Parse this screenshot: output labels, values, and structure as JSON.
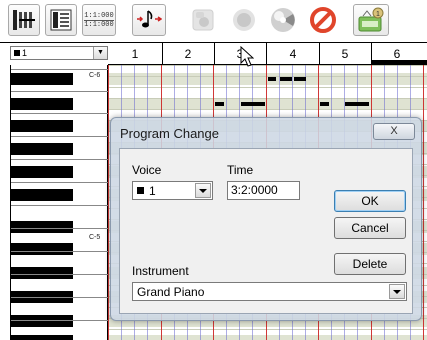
{
  "toolbar": {
    "buttons": [
      {
        "name": "track-view-icon"
      },
      {
        "name": "list-view-icon"
      },
      {
        "name": "time-signature-button",
        "top": "1:1:000",
        "bottom": "1:1:000"
      },
      {
        "name": "note-input-icon"
      },
      {
        "name": "play-icon"
      },
      {
        "name": "record-icon"
      },
      {
        "name": "metronome-icon"
      },
      {
        "name": "stop-icon"
      },
      {
        "name": "instrument-icon"
      }
    ]
  },
  "editor": {
    "track_selector": "1",
    "measures": [
      "1",
      "2",
      "3",
      "4",
      "5",
      "6"
    ],
    "octave_labels": [
      "C-6",
      "C-5"
    ]
  },
  "dialog": {
    "title": "Program Change",
    "close_label": "X",
    "voice_label": "Voice",
    "voice_value": "1",
    "time_label": "Time",
    "time_value": "3:2:0000",
    "ok_label": "OK",
    "cancel_label": "Cancel",
    "delete_label": "Delete",
    "instrument_label": "Instrument",
    "instrument_value": "Grand Piano"
  },
  "colors": {
    "measure_line": "#cc2222",
    "beat_line": "#6a6ad0",
    "row_shade": "#dfe3d2",
    "dialog_frame": "#cdd7e4"
  }
}
